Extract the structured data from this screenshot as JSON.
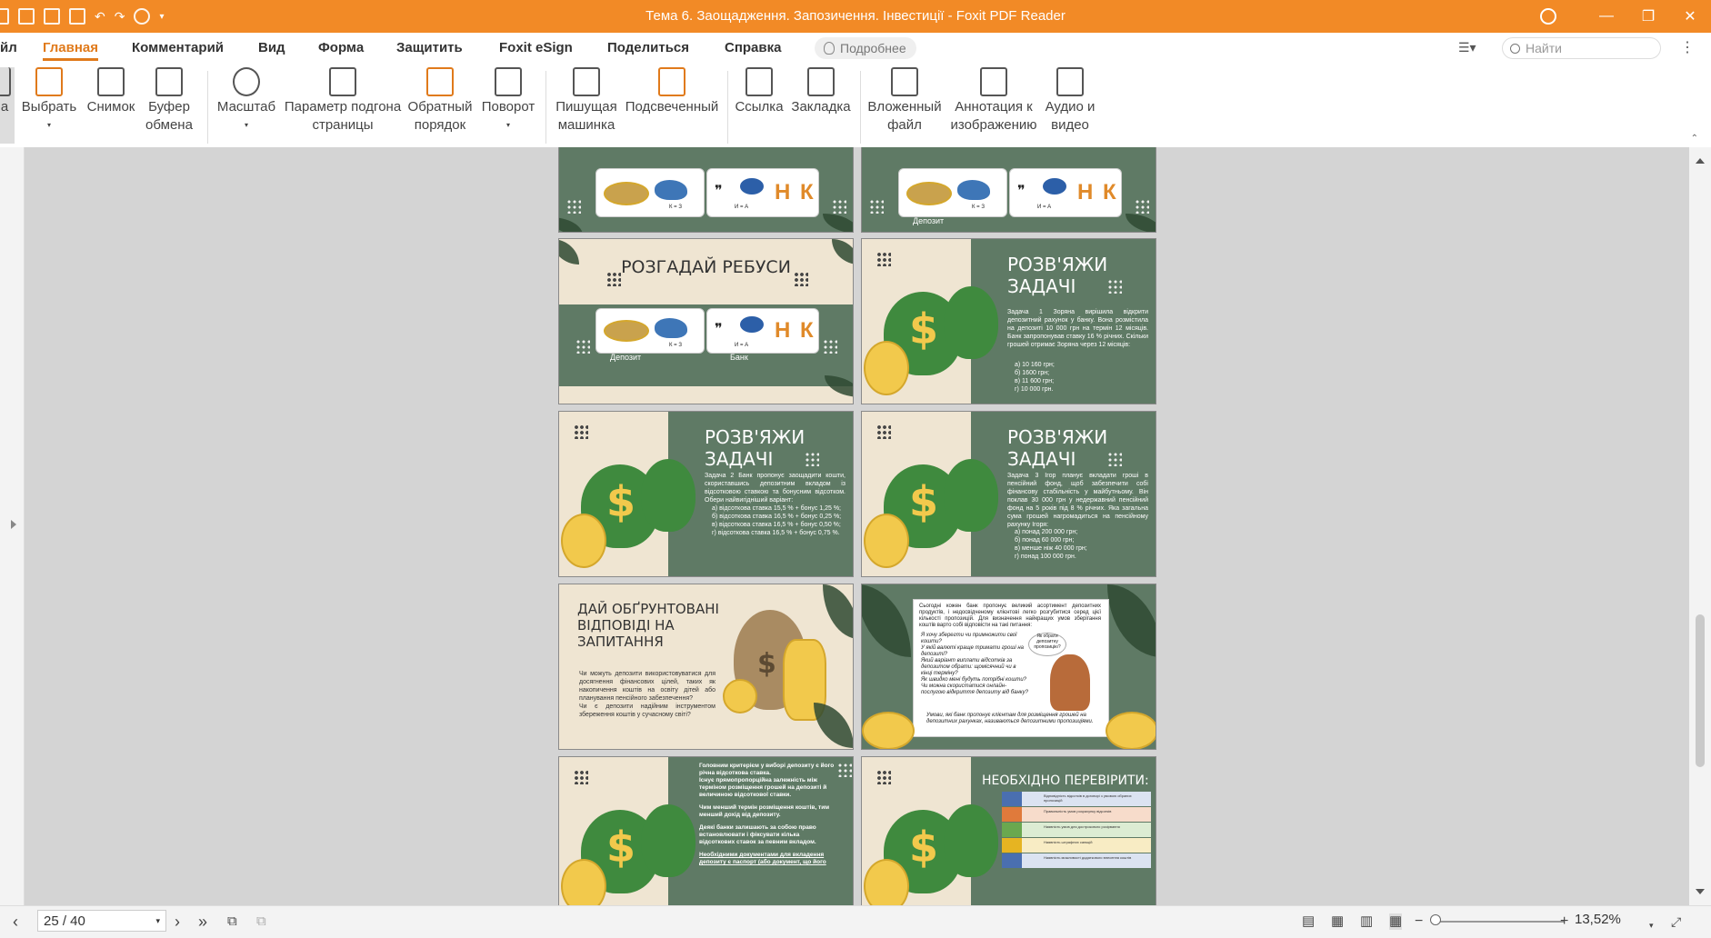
{
  "window": {
    "title": "Тема 6. Заощадження. Запозичення. Інвестиції - Foxit PDF Reader"
  },
  "menu": {
    "items": [
      "йл",
      "Главная",
      "Комментарий",
      "Вид",
      "Форма",
      "Защитить",
      "Foxit eSign",
      "Поделиться",
      "Справка"
    ],
    "active": "Главная",
    "tell_me": "Подробнее",
    "search_placeholder": "Найти"
  },
  "ribbon": {
    "buttons": [
      {
        "label": "а",
        "icon": "hand-icon"
      },
      {
        "label": "Выбрать",
        "icon": "select-text-icon"
      },
      {
        "label": "Снимок",
        "icon": "snapshot-icon"
      },
      {
        "label": "Буфер обмена",
        "icon": "clipboard-icon"
      },
      {
        "label": "Масштаб",
        "icon": "zoom-icon"
      },
      {
        "label": "Параметр подгона страницы",
        "icon": "fit-page-icon"
      },
      {
        "label": "Обратный порядок",
        "icon": "reverse-order-icon"
      },
      {
        "label": "Поворот",
        "icon": "rotate-icon"
      },
      {
        "label": "Пишущая машинка",
        "icon": "typewriter-icon"
      },
      {
        "label": "Подсвеченный",
        "icon": "highlight-icon"
      },
      {
        "label": "Ссылка",
        "icon": "link-icon"
      },
      {
        "label": "Закладка",
        "icon": "bookmark-icon"
      },
      {
        "label": "Вложенный файл",
        "icon": "attachment-icon"
      },
      {
        "label": "Аннотация к изображению",
        "icon": "image-annotation-icon"
      },
      {
        "label": "Аудио и видео",
        "icon": "audio-video-icon"
      }
    ]
  },
  "slides": {
    "r0_left_caption": "",
    "r0_right_caption": "Депозит",
    "rebus_title": "РОЗГАДАЙ РЕБУСИ",
    "rebus_k": "К = З",
    "rebus_i": "И = А",
    "rebus_letters": "Н К",
    "rebus_cap1": "Депозит",
    "rebus_cap2": "Банк",
    "task_title_1": "РОЗВ'ЯЖИ",
    "task_title_2": "ЗАДАЧІ",
    "task1_text": "Задача 1 Зоряна вирішила відкрити депозитний рахунок у банку. Вона розмістила на депозиті 10 000 грн на термін 12 місяців. Банк запропонував ставку 16 % річних. Скільки грошей отримає Зоряна через 12 місяців:",
    "task1_opts": [
      "а) 10 160 грн;",
      "б) 1600 грн;",
      "в) 11 600 грн;",
      "г) 10 000 грн."
    ],
    "task2_text": "Задача 2 Банк пропонує заощадити кошти, скориставшись депозитним вкладом із відсотковою ставкою та бонусним відсотком. Обери найвигідніший варіант:",
    "task2_opts": [
      "а) відсоткова ставка 15,5 % + бонус 1,25 %;",
      "б) відсоткова ставка 16,5 % + бонус 0,25 %;",
      "в) відсоткова ставка 16,5 % + бонус 0,50 %;",
      "г) відсоткова ставка 16,5 % + бонус 0,75 %."
    ],
    "task3_text": "Задача 3 Ігор планує вкладати гроші в пенсійний фонд, щоб забезпечити собі фінансову стабільність у майбутньому. Він поклав 30 000 грн у недержавний пенсійний фонд на 5 років під 8 % річних. Яка загальна сума грошей нагромадиться на пенсійному рахунку Ігоря:",
    "task3_opts": [
      "а) понад 200 000 грн;",
      "б) понад 60 000 грн;",
      "в) менше ніж 40 000 грн;",
      "г) понад 100 000 грн."
    ],
    "answers_title": "ДАЙ ОБҐРУНТОВАНІ ВІДПОВІДІ НА ЗАПИТАННЯ",
    "answers_q": [
      "Чи можуть депозити використовуватися для досягнення фінансових цілей, таких як накопичення коштів на освіту дітей або планування пенсійного забезпечення?",
      "Чи є депозити надійним інструментом збереження коштів у сучасному світі?"
    ],
    "choice_text": "Сьогодні кожен банк пропонує великий асортимент депозитних продуктів, і недосвідченому клієнтові легко розгубитися серед цієї кількості пропозицій. Для визначення найкращих умов зберігання коштів варто собі відповісти на такі питання:",
    "choice_list": [
      "Я хочу зберегти чи примножити свої кошти?",
      "У якій валюті краще тримати гроші на депозиті?",
      "Який варіант виплати відсотків за депозитом обрати: щомісячний чи в кінці терміну?",
      "Як швидко мені будуть потрібні кошти?",
      "Чи можна скористатися онлайн-послугою відкриття депозиту від банку?"
    ],
    "choice_bubble": "Як обрати депозитну пропозицію?",
    "choice_footer": "Умови, які банк пропонує клієнтам для розміщення грошей на депозитних рахунках, називаються депозитними пропозиціями.",
    "criteria_text": [
      "Головним критерієм у виборі депозиту є його річна відсоткова ставка.",
      "Існує прямопропорційна залежність між терміном розміщення грошей на депозиті й величиною відсоткової ставки.",
      "Чим менший термін розміщення коштів, тим менший дохід від депозиту.",
      "Деякі банки залишають за собою право встановлювати і фіксувати кілька відсоткових ставок за певним вкладом.",
      "Необхідними документами для вкладення депозиту є паспорт (або документ, що його"
    ],
    "check_title": "НЕОБХІДНО ПЕРЕВІРИТИ:",
    "check_rows": [
      "Відповідність відсотків в договорі з умовою обраних пропозицій",
      "Правильність умов розрахунку відсотків",
      "Наявність умов для дострокового розірвання",
      "Наявність штрафних санкцій",
      "Наявність можливості додаткового внесення коштів"
    ]
  },
  "status": {
    "page": "25 / 40",
    "zoom": "13,52%"
  },
  "colors": {
    "accent": "#f28a26",
    "slide_green": "#5f7a65",
    "slide_beige": "#efe5d2"
  }
}
